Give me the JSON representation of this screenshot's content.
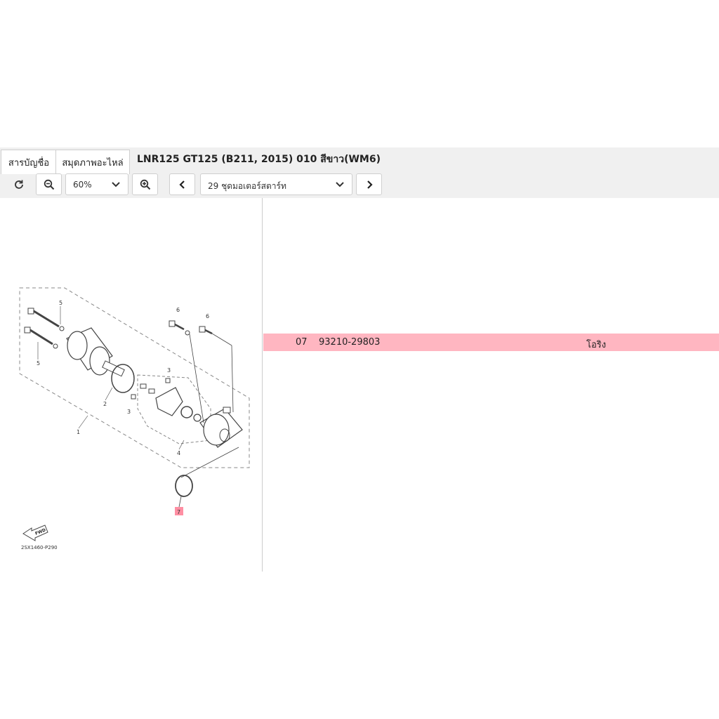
{
  "tabs": [
    {
      "label": "สารบัญชื่อ"
    },
    {
      "label": "สมุดภาพอะไหล่"
    }
  ],
  "page_title": "LNR125 GT125 (B211, 2015) 010 สีขาว(WM6)",
  "toolbar": {
    "zoom_value": "60%",
    "section_value": "29 ชุดมอเตอร์สตาร์ท"
  },
  "parts_table": {
    "rows": [
      {
        "ref": "07",
        "part_number": "93210-29803",
        "name": "โอริง"
      }
    ]
  },
  "diagram": {
    "callouts": [
      "1",
      "2",
      "3",
      "3",
      "4",
      "5",
      "5",
      "6",
      "6",
      "7"
    ],
    "fwd_label": "FWD",
    "code": "2SX1460-P290"
  },
  "colors": {
    "highlight": "#ffb6c1",
    "toolbar_bg": "#f0f0f0"
  }
}
